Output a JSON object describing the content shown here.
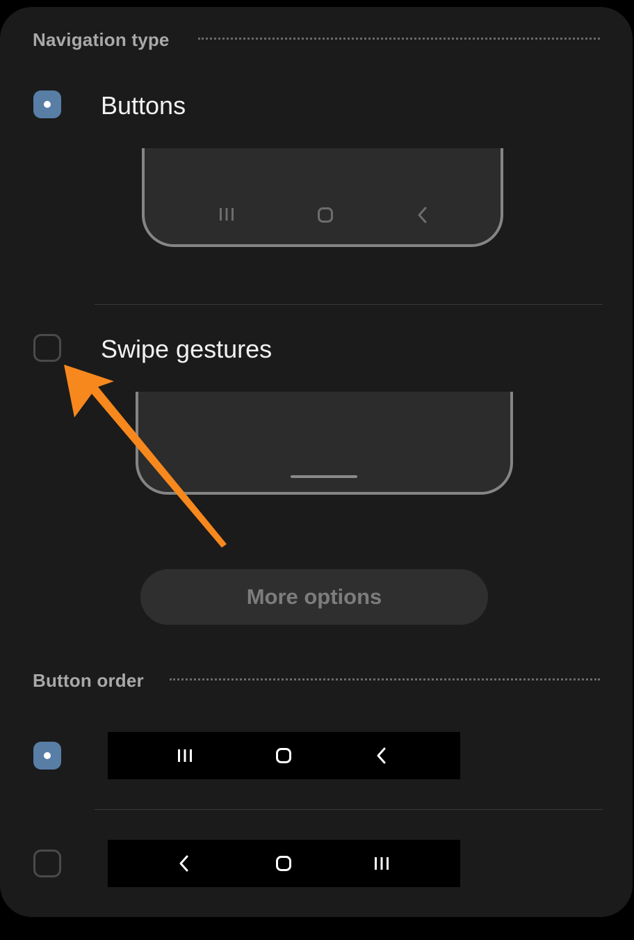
{
  "navigation_type": {
    "title": "Navigation type",
    "options": [
      {
        "label": "Buttons",
        "selected": true,
        "preview_icons": [
          "recents-icon",
          "home-icon",
          "back-icon"
        ]
      },
      {
        "label": "Swipe gestures",
        "selected": false,
        "preview_icons": [
          "gesture-handle-icon"
        ]
      }
    ],
    "more_options_label": "More options"
  },
  "button_order": {
    "title": "Button order",
    "options": [
      {
        "selected": true,
        "icons": [
          "recents-icon",
          "home-icon",
          "back-icon"
        ]
      },
      {
        "selected": false,
        "icons": [
          "back-icon",
          "home-icon",
          "recents-icon"
        ]
      }
    ]
  },
  "colors": {
    "accent": "#587ea6",
    "annotation_arrow": "#f7881e",
    "background": "#1b1b1b"
  }
}
